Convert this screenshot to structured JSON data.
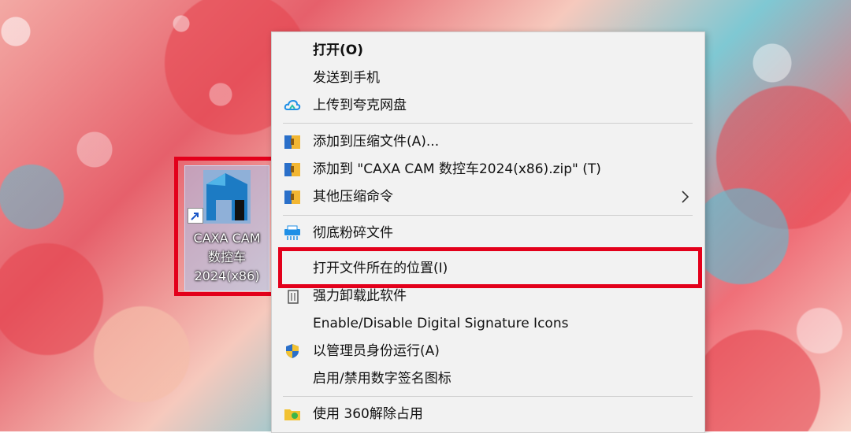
{
  "desktop_icon": {
    "label_lines": [
      "CAXA CAM",
      "数控车",
      "2024(x86)"
    ]
  },
  "context_menu": {
    "items": [
      {
        "label": "打开(O)",
        "icon": "none"
      },
      {
        "label": "发送到手机",
        "icon": "none"
      },
      {
        "label": "上传到夸克网盘",
        "icon": "cloud-upload-icon"
      },
      {
        "label": "添加到压缩文件(A)...",
        "icon": "archive-icon"
      },
      {
        "label": "添加到 \"CAXA CAM 数控车2024(x86).zip\" (T)",
        "icon": "archive-icon"
      },
      {
        "label": "其他压缩命令",
        "icon": "archive-icon"
      },
      {
        "label": "彻底粉碎文件",
        "icon": "shredder-icon"
      },
      {
        "label": "打开文件所在的位置(I)",
        "icon": "none"
      },
      {
        "label": "强力卸载此软件",
        "icon": "uninstall-icon"
      },
      {
        "label": "Enable/Disable Digital Signature Icons",
        "icon": "none"
      },
      {
        "label": "以管理员身份运行(A)",
        "icon": "shield-icon"
      },
      {
        "label": "启用/禁用数字签名图标",
        "icon": "none"
      },
      {
        "label": "使用 360解除占用",
        "icon": "folder-360-icon"
      }
    ],
    "highlighted_item": "打开文件所在的位置(I)"
  },
  "colors": {
    "highlight_border": "#e3001b",
    "menu_background": "#f2f2f2"
  }
}
